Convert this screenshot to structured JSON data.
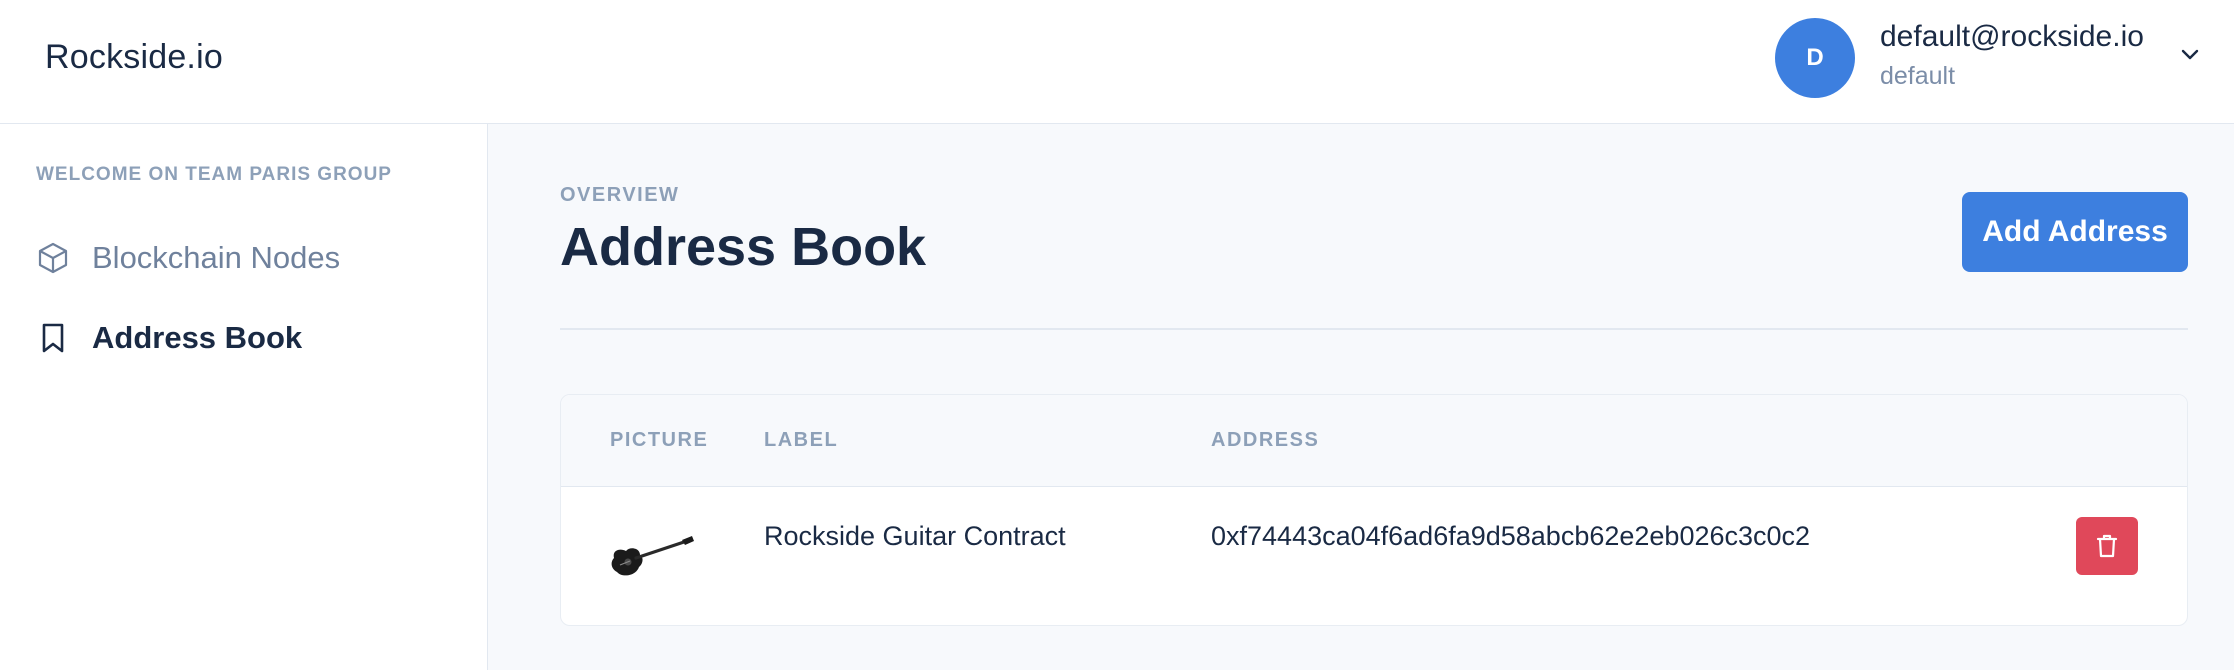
{
  "header": {
    "brand": "Rockside.io",
    "avatar_initial": "D",
    "user_email": "default@rockside.io",
    "user_org": "default",
    "menu_icon": "chevron-down-icon"
  },
  "sidebar": {
    "welcome": "WELCOME ON TEAM PARIS GROUP",
    "items": [
      {
        "label": "Blockchain Nodes",
        "icon": "cube-icon",
        "active": false
      },
      {
        "label": "Address Book",
        "icon": "bookmark-icon",
        "active": true
      }
    ]
  },
  "main": {
    "overline": "OVERVIEW",
    "title": "Address Book",
    "add_button": "Add Address",
    "table": {
      "columns": [
        "PICTURE",
        "LABEL",
        "ADDRESS"
      ],
      "rows": [
        {
          "picture": "guitar-icon",
          "label": "Rockside Guitar Contract",
          "address": "0xf74443ca04f6ad6fa9d58abcb62e2eb026c3c0c2",
          "action_icon": "trash-icon"
        }
      ]
    }
  },
  "colors": {
    "accent": "#3d7fdf",
    "danger": "#e0485a",
    "text": "#1a2a44",
    "muted": "#8da0b8"
  }
}
